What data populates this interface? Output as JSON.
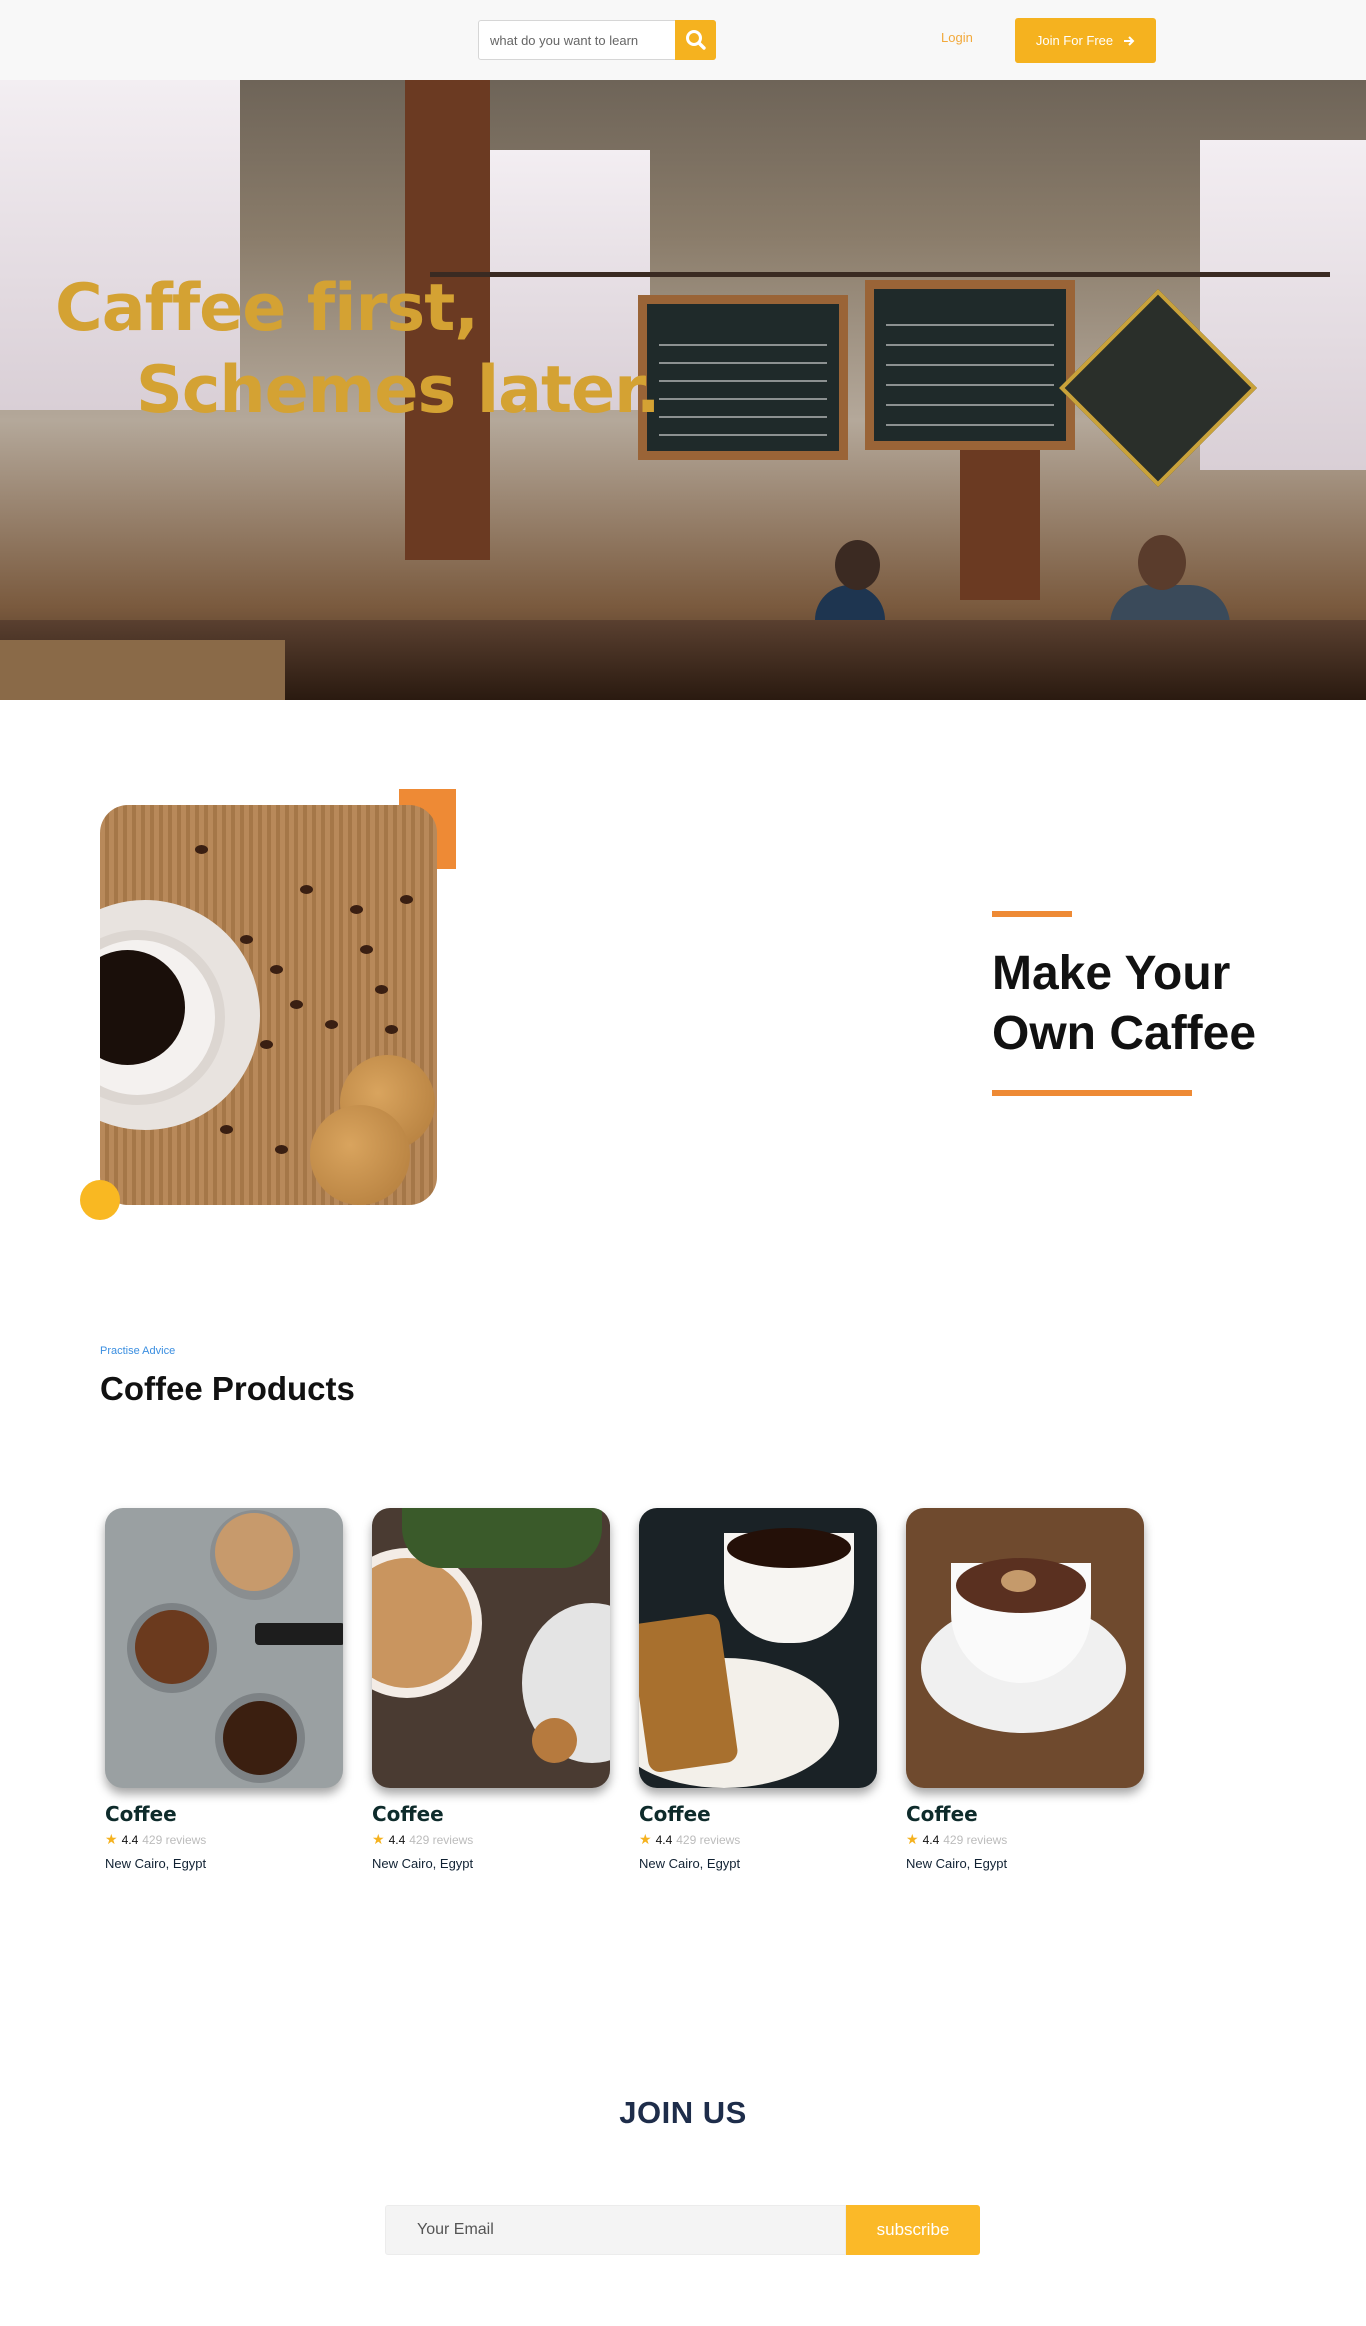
{
  "header": {
    "search_placeholder": "what do you want to learn",
    "search_icon": "search-icon",
    "login_label": "Login",
    "join_label": "Join For Free",
    "join_icon": "arrow-right-icon",
    "accent_color": "#f5b21f"
  },
  "hero": {
    "title_line1": "Caffee first,",
    "title_line2": "Schemes later.",
    "title_color": "#d4a233"
  },
  "feature": {
    "title_line1": "Make Your",
    "title_line2": "Own Caffee",
    "accent_color": "#ee8a35"
  },
  "products_section": {
    "eyebrow": "Practise Advice",
    "title": "Coffee Products",
    "items": [
      {
        "name": "Coffee",
        "score": "4.4",
        "reviews": "429 reviews",
        "location": "New Cairo, Egypt"
      },
      {
        "name": "Coffee",
        "score": "4.4",
        "reviews": "429 reviews",
        "location": "New Cairo, Egypt"
      },
      {
        "name": "Coffee",
        "score": "4.4",
        "reviews": "429 reviews",
        "location": "New Cairo, Egypt"
      },
      {
        "name": "Coffee",
        "score": "4.4",
        "reviews": "429 reviews",
        "location": "New Cairo, Egypt"
      }
    ]
  },
  "join": {
    "title": "JOIN US",
    "email_placeholder": "Your Email",
    "subscribe_label": "subscribe"
  }
}
